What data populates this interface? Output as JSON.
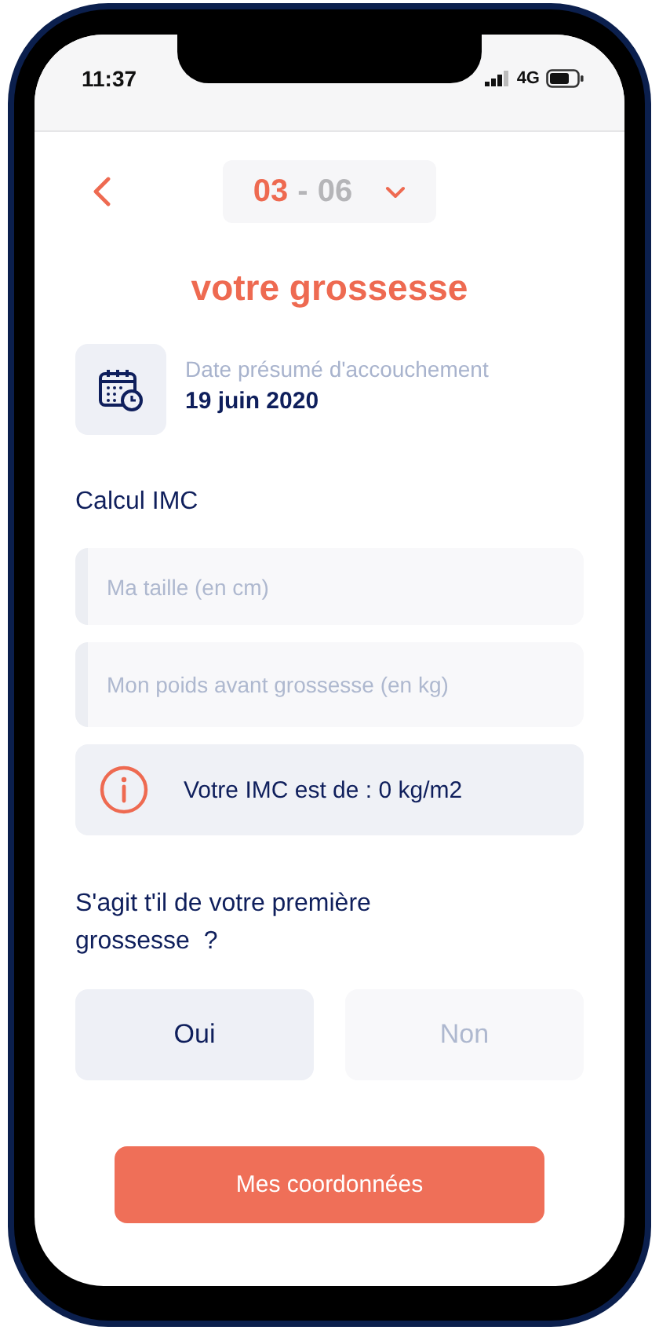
{
  "status_bar": {
    "time": "11:37",
    "network": "4G"
  },
  "header": {
    "step": {
      "current": "03",
      "separator": "-",
      "total": "06"
    }
  },
  "title": "votre grossesse",
  "due_date": {
    "label": "Date présumé d'accouchement",
    "value": "19 juin 2020"
  },
  "bmi": {
    "heading": "Calcul IMC",
    "fields": [
      {
        "placeholder": "Ma taille (en cm)"
      },
      {
        "placeholder": "Mon poids avant grossesse (en kg)"
      }
    ],
    "result": "Votre IMC est de : 0 kg/m2"
  },
  "first_pregnancy": {
    "question": "S'agit t'il de votre première grossesse  ?",
    "options": [
      {
        "label": "Oui",
        "selected": true
      },
      {
        "label": "Non",
        "selected": false
      }
    ]
  },
  "button": "Mes coordonnées"
}
